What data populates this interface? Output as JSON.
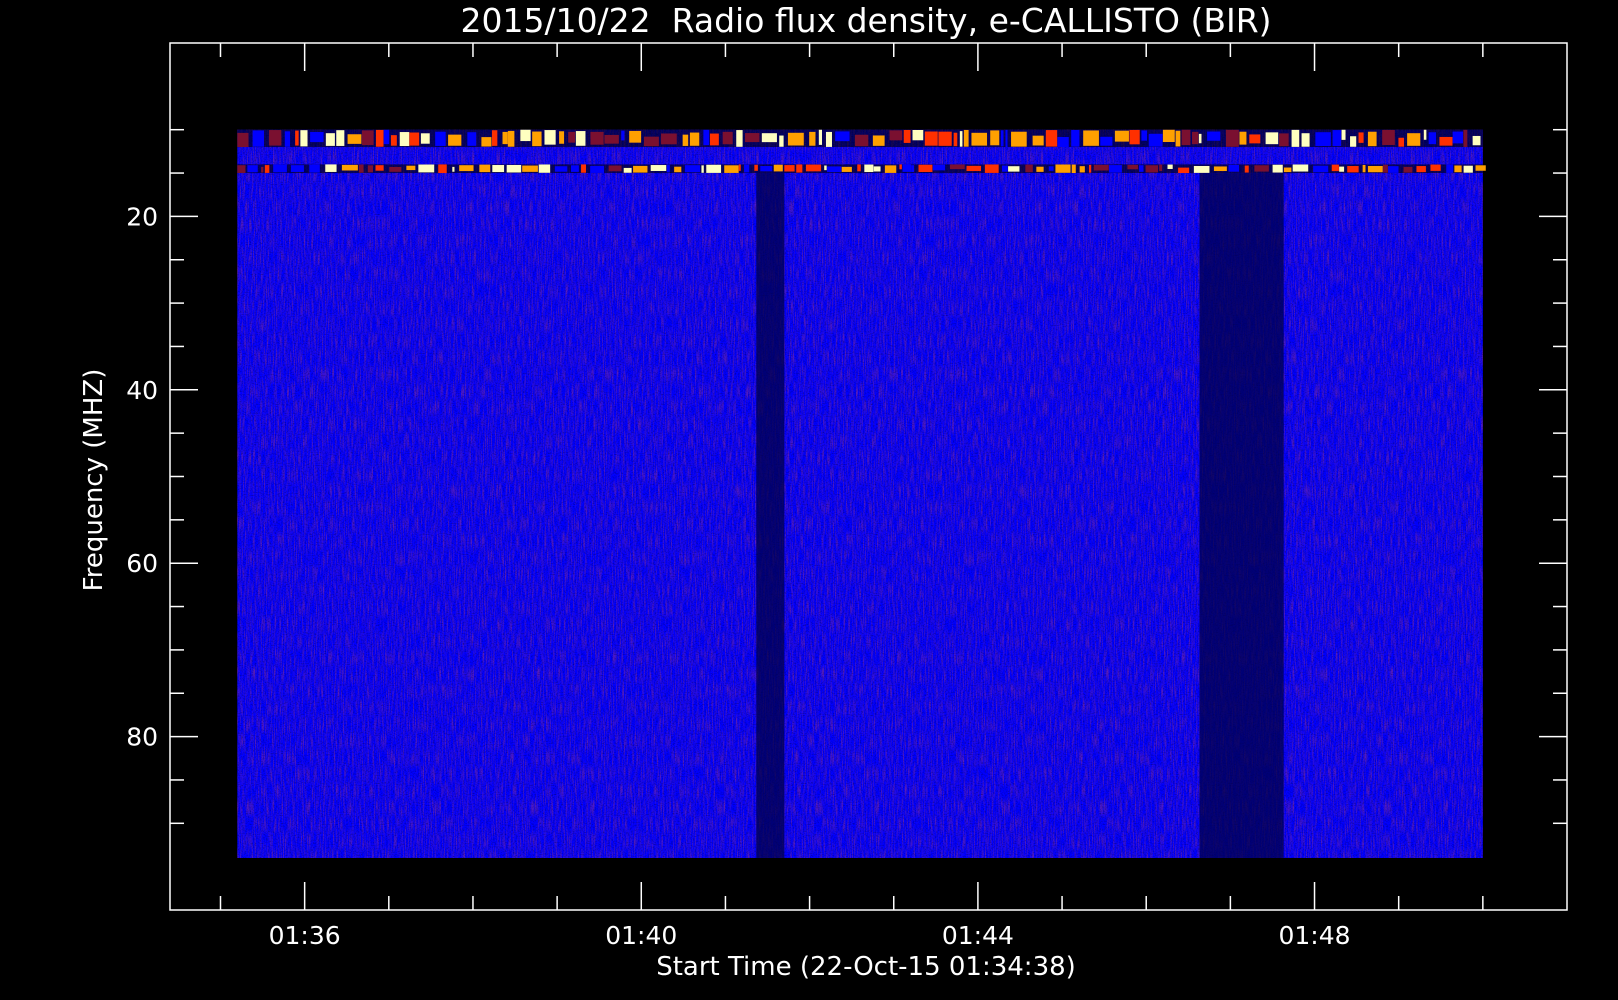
{
  "chart_data": {
    "type": "heatmap",
    "title": "2015/10/22  Radio flux density, e-CALLISTO (BIR)",
    "xlabel": "Start Time (22-Oct-15 01:34:38)",
    "ylabel": "Frequency (MHZ)",
    "xlim": [
      "01:34:24",
      "01:51:00"
    ],
    "ylim": [
      100,
      0
    ],
    "data_x_range": [
      "01:35:12",
      "01:50:00"
    ],
    "data_y_range": [
      10,
      94
    ],
    "x_ticks": [
      {
        "value": "01:36",
        "label": "01:36"
      },
      {
        "value": "01:40",
        "label": "01:40"
      },
      {
        "value": "01:44",
        "label": "01:44"
      },
      {
        "value": "01:48",
        "label": "01:48"
      }
    ],
    "y_ticks": [
      {
        "value": 20,
        "label": "20"
      },
      {
        "value": 40,
        "label": "40"
      },
      {
        "value": 60,
        "label": "60"
      },
      {
        "value": 80,
        "label": "80"
      }
    ],
    "colormap": [
      "#000000",
      "#0000ff",
      "#7a1030",
      "#ff3000",
      "#ffa000",
      "#ffffc0"
    ],
    "features": [
      {
        "kind": "intense-band",
        "freq_range": [
          10,
          12
        ],
        "time_range": [
          "01:35:12",
          "01:50:00"
        ]
      },
      {
        "kind": "intense-band",
        "freq_range": [
          14,
          15
        ],
        "time_range": [
          "01:35:12",
          "01:50:00"
        ]
      },
      {
        "kind": "dark-column",
        "freq_range": [
          15,
          94
        ],
        "time_range": [
          "01:46:38",
          "01:47:38"
        ]
      },
      {
        "kind": "dark-column",
        "freq_range": [
          15,
          94
        ],
        "time_range": [
          "01:41:22",
          "01:41:42"
        ]
      }
    ],
    "grid": false,
    "legend": "none"
  }
}
